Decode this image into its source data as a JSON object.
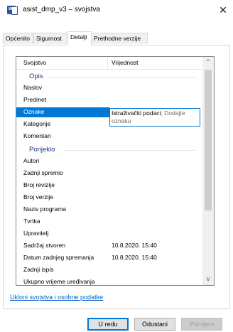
{
  "window": {
    "title": "asist_dmp_v3 – svojstva",
    "app_icon_letter": "w",
    "close_glyph": "✕"
  },
  "tabs": [
    {
      "label": "Općenito",
      "active": false
    },
    {
      "label": "Sigurnost",
      "active": false
    },
    {
      "label": "Detalji",
      "active": true
    },
    {
      "label": "Prethodne verzije",
      "active": false
    }
  ],
  "list": {
    "columns": {
      "property": "Svojstvo",
      "value": "Vrijednost"
    },
    "groups": {
      "description": "Opis",
      "origin": "Porijeklo"
    },
    "description_rows": [
      {
        "property": "Naslov",
        "value": ""
      },
      {
        "property": "Predmet",
        "value": ""
      },
      {
        "property": "Oznake",
        "value": ""
      },
      {
        "property": "Kategorije",
        "value": ""
      },
      {
        "property": "Komentari",
        "value": ""
      }
    ],
    "origin_rows": [
      {
        "property": "Autori",
        "value": ""
      },
      {
        "property": "Zadnji spremio",
        "value": ""
      },
      {
        "property": "Broj revizije",
        "value": ""
      },
      {
        "property": "Broj verzije",
        "value": ""
      },
      {
        "property": "Naziv programa",
        "value": ""
      },
      {
        "property": "Tvrtka",
        "value": ""
      },
      {
        "property": "Upravitelj",
        "value": ""
      },
      {
        "property": "Sadržaj stvoren",
        "value": "10.8.2020. 15:40"
      },
      {
        "property": "Datum zadnjeg spremanja",
        "value": "10.8.2020. 15:40"
      },
      {
        "property": "Zadnji ispis",
        "value": ""
      },
      {
        "property": "Ukupno vrijeme uređivanja",
        "value": ""
      }
    ],
    "selected_property": "Oznake",
    "edit_box": {
      "typed": "Istraživački podaci",
      "hint": "; Dodajte oznaku"
    }
  },
  "scrollbar": {
    "up_glyph": "^",
    "down_glyph": "v"
  },
  "remove_link": "Ukloni svojstva i osobne podatke",
  "buttons": {
    "ok": {
      "label": "U redu"
    },
    "cancel": {
      "label": "Odustani"
    },
    "apply": {
      "label": "Primijeni"
    }
  }
}
